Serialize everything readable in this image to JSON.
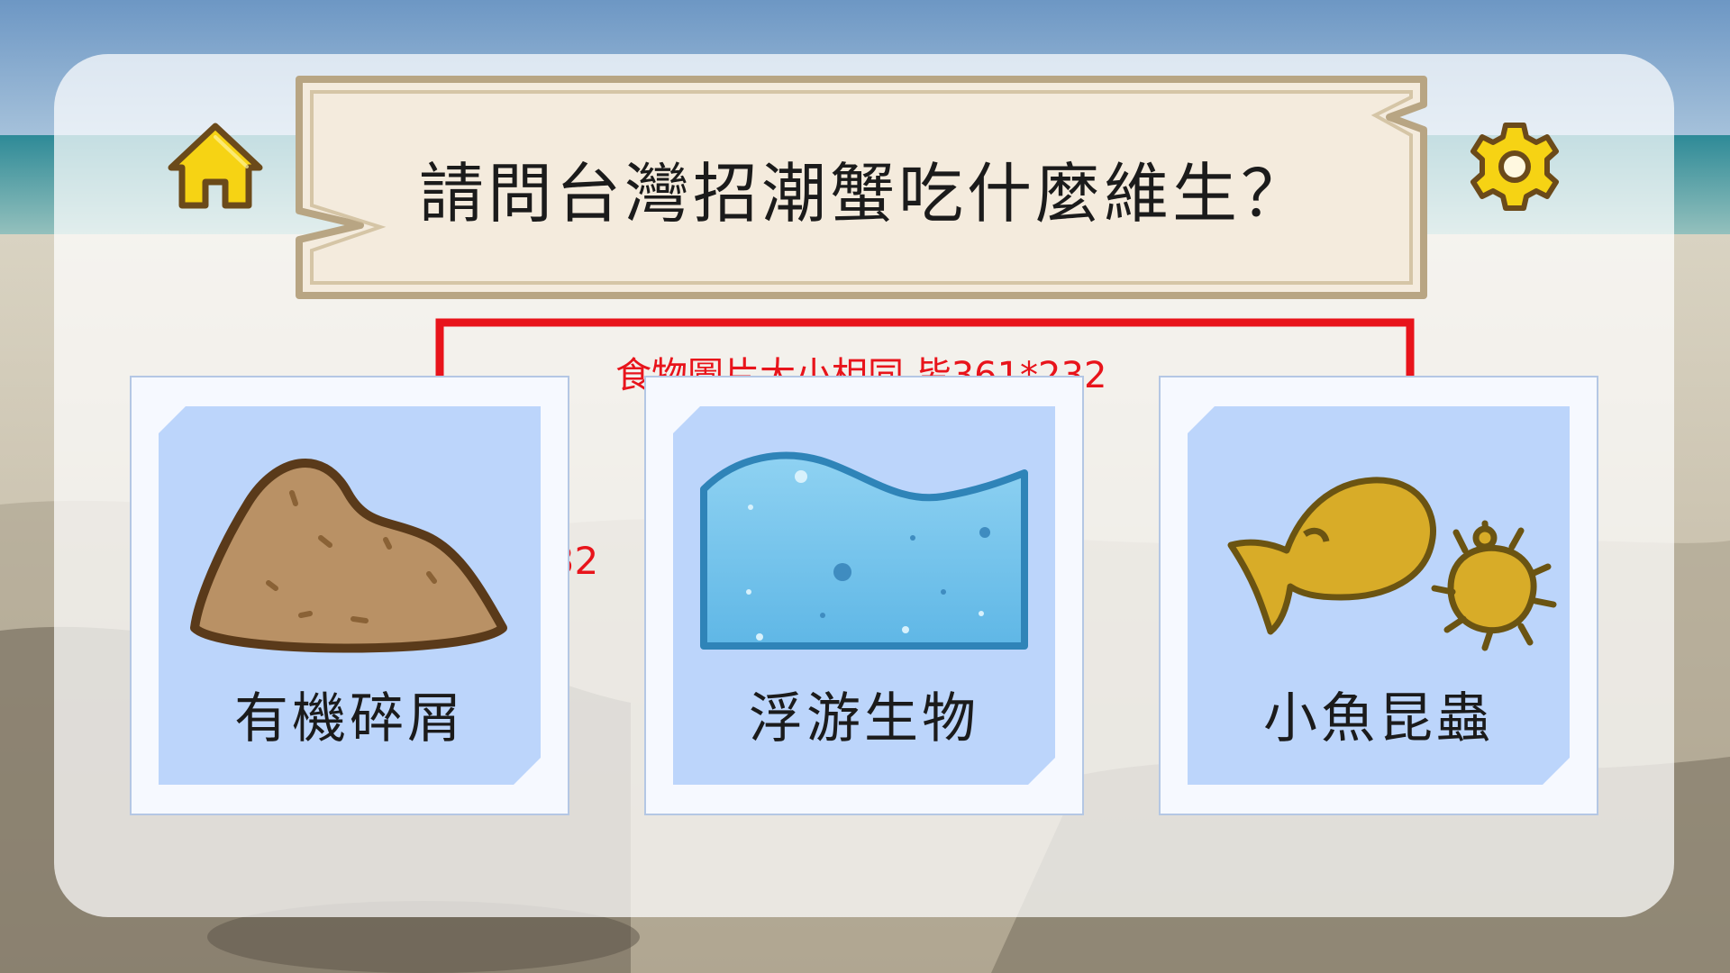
{
  "question": "請問台灣招潮蟹吃什麼維生？",
  "header": {
    "home_icon": "home-icon",
    "settings_icon": "gear-icon"
  },
  "options": [
    {
      "label": "有機碎屑",
      "icon": "sediment-mound-icon"
    },
    {
      "label": "浮游生物",
      "icon": "water-plankton-icon"
    },
    {
      "label": "小魚昆蟲",
      "icon": "fish-and-bug-icon"
    }
  ],
  "annotations": {
    "note": "食物圖片大小相同 皆361*232",
    "width_label": "361",
    "height_label": "232"
  },
  "colors": {
    "annotation": "#e8141b",
    "card_plate": "#bcd5fb",
    "banner_fill": "#f4ebdd",
    "banner_border": "#b8a583",
    "icon_yellow": "#f6d314"
  }
}
